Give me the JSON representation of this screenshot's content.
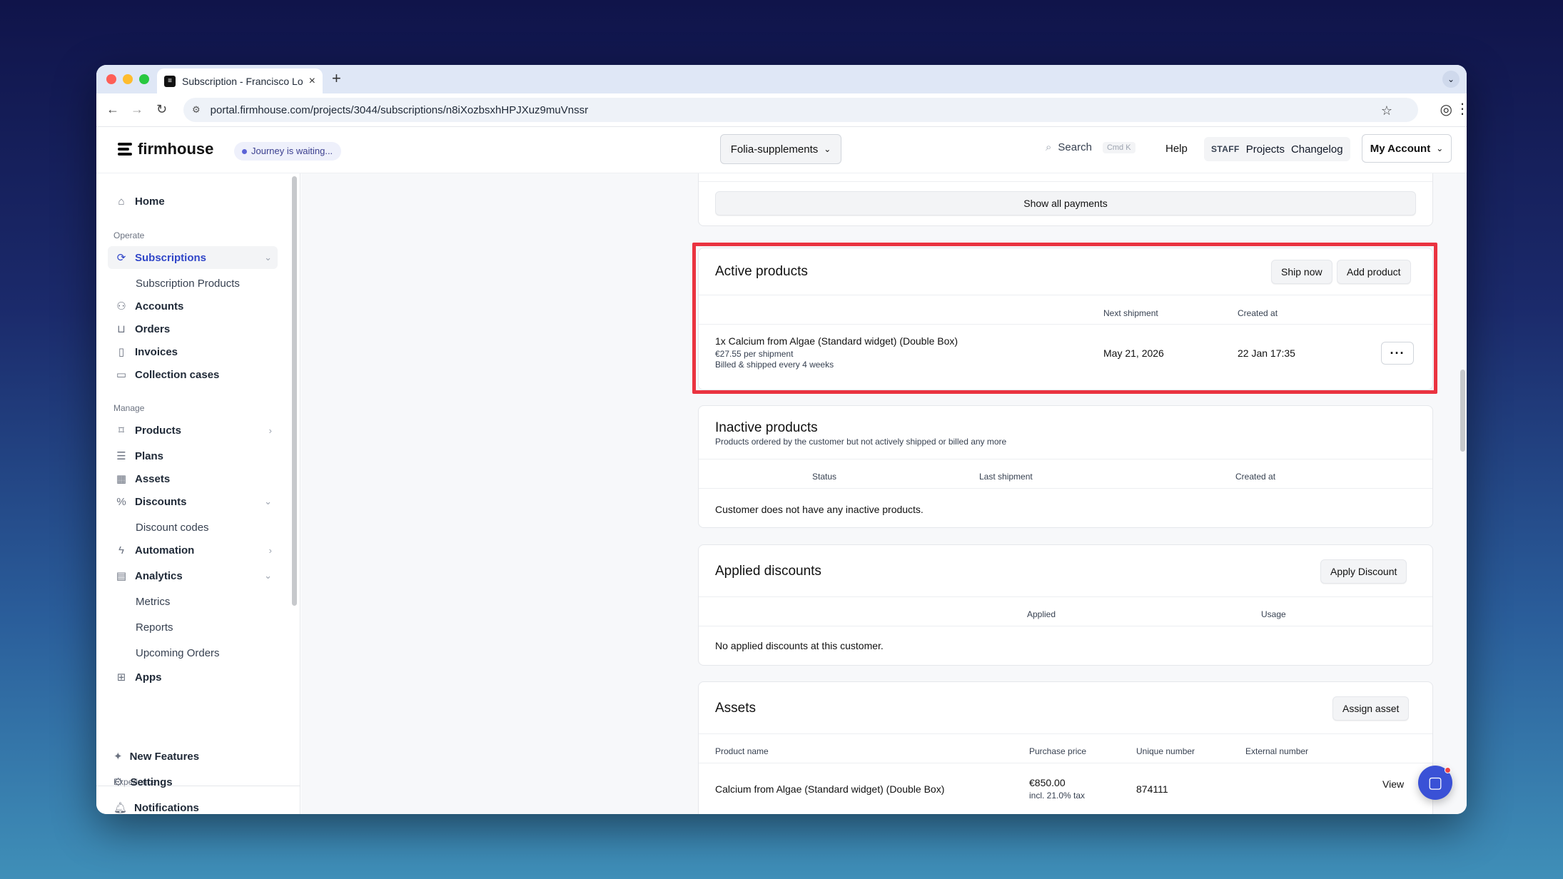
{
  "browser": {
    "tab_title": "Subscription - Francisco Lope",
    "tab_close": "×",
    "new_tab": "+",
    "url": "portal.firmhouse.com/projects/3044/subscriptions/n8iXozbsxhHPJXuz9muVnssr"
  },
  "header": {
    "logo_text": "firmhouse",
    "journey_badge": "Journey is waiting...",
    "project_select": "Folia-supplements",
    "search_label": "Search",
    "search_shortcut": "Cmd K",
    "help": "Help",
    "staff_tag": "STAFF",
    "projects": "Projects",
    "changelog": "Changelog",
    "account": "My Account"
  },
  "sidebar": {
    "home": "Home",
    "section_operate": "Operate",
    "subscriptions": "Subscriptions",
    "subscription_products": "Subscription Products",
    "accounts": "Accounts",
    "orders": "Orders",
    "invoices": "Invoices",
    "collection_cases": "Collection cases",
    "section_manage": "Manage",
    "products": "Products",
    "plans": "Plans",
    "assets": "Assets",
    "discounts": "Discounts",
    "discount_codes": "Discount codes",
    "automation": "Automation",
    "analytics": "Analytics",
    "metrics": "Metrics",
    "reports": "Reports",
    "upcoming_orders": "Upcoming Orders",
    "apps": "Apps",
    "section_experience": "Experience",
    "notifications": "Notifications",
    "new_features": "New Features",
    "settings": "Settings"
  },
  "payments": {
    "show_all": "Show all payments"
  },
  "active_products": {
    "title": "Active products",
    "ship_now": "Ship now",
    "add_product": "Add product",
    "col_next_shipment": "Next shipment",
    "col_created_at": "Created at",
    "row": {
      "name": "1x Calcium from Algae (Standard widget) (Double Box)",
      "price": "€27.55 per shipment",
      "frequency": "Billed & shipped every 4 weeks",
      "next_shipment": "May 21, 2026",
      "created_at": "22 Jan 17:35",
      "menu": "···"
    }
  },
  "inactive_products": {
    "title": "Inactive products",
    "subtitle": "Products ordered by the customer but not actively shipped or billed any more",
    "col_status": "Status",
    "col_last_shipment": "Last shipment",
    "col_created_at": "Created at",
    "empty": "Customer does not have any inactive products."
  },
  "applied_discounts": {
    "title": "Applied discounts",
    "apply": "Apply Discount",
    "col_applied": "Applied",
    "col_usage": "Usage",
    "empty": "No applied discounts at this customer."
  },
  "assets": {
    "title": "Assets",
    "assign": "Assign asset",
    "col_product_name": "Product name",
    "col_purchase_price": "Purchase price",
    "col_unique_number": "Unique number",
    "col_external_number": "External number",
    "row": {
      "name": "Calcium from Algae (Standard widget) (Double Box)",
      "price": "€850.00",
      "tax": "incl. 21.0% tax",
      "unique_number": "874111",
      "view": "View"
    }
  },
  "colors": {
    "accent": "#3046c8",
    "highlight": "#ea3340"
  }
}
